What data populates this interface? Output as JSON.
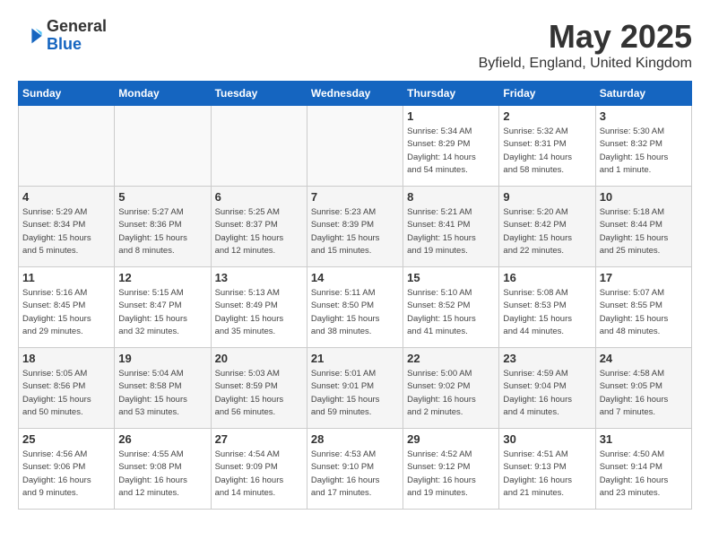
{
  "header": {
    "logo_general": "General",
    "logo_blue": "Blue",
    "title": "May 2025",
    "subtitle": "Byfield, England, United Kingdom"
  },
  "weekdays": [
    "Sunday",
    "Monday",
    "Tuesday",
    "Wednesday",
    "Thursday",
    "Friday",
    "Saturday"
  ],
  "weeks": [
    [
      {
        "day": "",
        "info": ""
      },
      {
        "day": "",
        "info": ""
      },
      {
        "day": "",
        "info": ""
      },
      {
        "day": "",
        "info": ""
      },
      {
        "day": "1",
        "info": "Sunrise: 5:34 AM\nSunset: 8:29 PM\nDaylight: 14 hours\nand 54 minutes."
      },
      {
        "day": "2",
        "info": "Sunrise: 5:32 AM\nSunset: 8:31 PM\nDaylight: 14 hours\nand 58 minutes."
      },
      {
        "day": "3",
        "info": "Sunrise: 5:30 AM\nSunset: 8:32 PM\nDaylight: 15 hours\nand 1 minute."
      }
    ],
    [
      {
        "day": "4",
        "info": "Sunrise: 5:29 AM\nSunset: 8:34 PM\nDaylight: 15 hours\nand 5 minutes."
      },
      {
        "day": "5",
        "info": "Sunrise: 5:27 AM\nSunset: 8:36 PM\nDaylight: 15 hours\nand 8 minutes."
      },
      {
        "day": "6",
        "info": "Sunrise: 5:25 AM\nSunset: 8:37 PM\nDaylight: 15 hours\nand 12 minutes."
      },
      {
        "day": "7",
        "info": "Sunrise: 5:23 AM\nSunset: 8:39 PM\nDaylight: 15 hours\nand 15 minutes."
      },
      {
        "day": "8",
        "info": "Sunrise: 5:21 AM\nSunset: 8:41 PM\nDaylight: 15 hours\nand 19 minutes."
      },
      {
        "day": "9",
        "info": "Sunrise: 5:20 AM\nSunset: 8:42 PM\nDaylight: 15 hours\nand 22 minutes."
      },
      {
        "day": "10",
        "info": "Sunrise: 5:18 AM\nSunset: 8:44 PM\nDaylight: 15 hours\nand 25 minutes."
      }
    ],
    [
      {
        "day": "11",
        "info": "Sunrise: 5:16 AM\nSunset: 8:45 PM\nDaylight: 15 hours\nand 29 minutes."
      },
      {
        "day": "12",
        "info": "Sunrise: 5:15 AM\nSunset: 8:47 PM\nDaylight: 15 hours\nand 32 minutes."
      },
      {
        "day": "13",
        "info": "Sunrise: 5:13 AM\nSunset: 8:49 PM\nDaylight: 15 hours\nand 35 minutes."
      },
      {
        "day": "14",
        "info": "Sunrise: 5:11 AM\nSunset: 8:50 PM\nDaylight: 15 hours\nand 38 minutes."
      },
      {
        "day": "15",
        "info": "Sunrise: 5:10 AM\nSunset: 8:52 PM\nDaylight: 15 hours\nand 41 minutes."
      },
      {
        "day": "16",
        "info": "Sunrise: 5:08 AM\nSunset: 8:53 PM\nDaylight: 15 hours\nand 44 minutes."
      },
      {
        "day": "17",
        "info": "Sunrise: 5:07 AM\nSunset: 8:55 PM\nDaylight: 15 hours\nand 48 minutes."
      }
    ],
    [
      {
        "day": "18",
        "info": "Sunrise: 5:05 AM\nSunset: 8:56 PM\nDaylight: 15 hours\nand 50 minutes."
      },
      {
        "day": "19",
        "info": "Sunrise: 5:04 AM\nSunset: 8:58 PM\nDaylight: 15 hours\nand 53 minutes."
      },
      {
        "day": "20",
        "info": "Sunrise: 5:03 AM\nSunset: 8:59 PM\nDaylight: 15 hours\nand 56 minutes."
      },
      {
        "day": "21",
        "info": "Sunrise: 5:01 AM\nSunset: 9:01 PM\nDaylight: 15 hours\nand 59 minutes."
      },
      {
        "day": "22",
        "info": "Sunrise: 5:00 AM\nSunset: 9:02 PM\nDaylight: 16 hours\nand 2 minutes."
      },
      {
        "day": "23",
        "info": "Sunrise: 4:59 AM\nSunset: 9:04 PM\nDaylight: 16 hours\nand 4 minutes."
      },
      {
        "day": "24",
        "info": "Sunrise: 4:58 AM\nSunset: 9:05 PM\nDaylight: 16 hours\nand 7 minutes."
      }
    ],
    [
      {
        "day": "25",
        "info": "Sunrise: 4:56 AM\nSunset: 9:06 PM\nDaylight: 16 hours\nand 9 minutes."
      },
      {
        "day": "26",
        "info": "Sunrise: 4:55 AM\nSunset: 9:08 PM\nDaylight: 16 hours\nand 12 minutes."
      },
      {
        "day": "27",
        "info": "Sunrise: 4:54 AM\nSunset: 9:09 PM\nDaylight: 16 hours\nand 14 minutes."
      },
      {
        "day": "28",
        "info": "Sunrise: 4:53 AM\nSunset: 9:10 PM\nDaylight: 16 hours\nand 17 minutes."
      },
      {
        "day": "29",
        "info": "Sunrise: 4:52 AM\nSunset: 9:12 PM\nDaylight: 16 hours\nand 19 minutes."
      },
      {
        "day": "30",
        "info": "Sunrise: 4:51 AM\nSunset: 9:13 PM\nDaylight: 16 hours\nand 21 minutes."
      },
      {
        "day": "31",
        "info": "Sunrise: 4:50 AM\nSunset: 9:14 PM\nDaylight: 16 hours\nand 23 minutes."
      }
    ]
  ]
}
